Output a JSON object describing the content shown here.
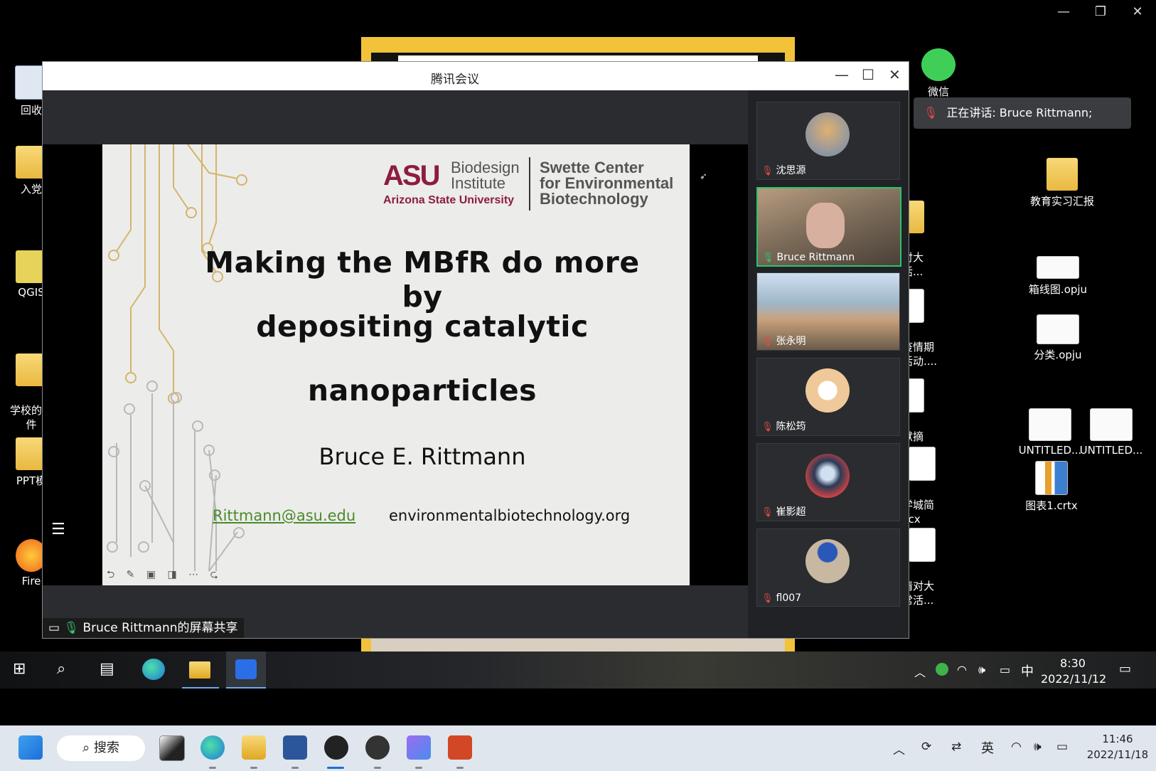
{
  "outer_window": {
    "minimize": "—",
    "restore": "❐",
    "close": "✕"
  },
  "desktop_left": [
    {
      "label": "回收",
      "kind": "recycle"
    },
    {
      "label": "入党",
      "kind": "folder"
    },
    {
      "label": "QGIS",
      "kind": "app"
    },
    {
      "label": "学校的一\n件",
      "kind": "folder"
    },
    {
      "label": "PPT模",
      "kind": "folder"
    },
    {
      "label": "Fire",
      "kind": "firefox"
    }
  ],
  "desktop_right": [
    {
      "label": "微信",
      "kind": "wechat"
    },
    {
      "label": "教育实习汇报",
      "kind": "folder"
    },
    {
      "label": "箱线图.opju",
      "kind": "chart"
    },
    {
      "label": "分类.opju",
      "kind": "chart"
    },
    {
      "label": "UNTITLED...",
      "kind": "chart"
    },
    {
      "label": "UNTITLED...",
      "kind": "chart"
    },
    {
      "label": "图表1.crtx",
      "kind": "crtx"
    }
  ],
  "desktop_mid": [
    {
      "label": "情对大\n常活..."
    },
    {
      "label": "主疫情期\n会活动...."
    },
    {
      "label": "文献摘\n.docx"
    },
    {
      "label": "大学城简\n.docx"
    },
    {
      "label": "疫情对大\n日常活..."
    }
  ],
  "meeting": {
    "title": "腾讯会议",
    "minimize": "—",
    "maximize": "☐",
    "close": "✕",
    "share_label": "Bruce Rittmann的屏幕共享",
    "slide": {
      "asu_mark": "ASU",
      "biodesign_line1": "Biodesign",
      "biodesign_line2": "Institute",
      "university": "Arizona State University",
      "swette_line1": "Swette Center",
      "swette_line2": "for Environmental",
      "swette_line3": "Biotechnology",
      "title_line1": "Making the MBfR do more by",
      "title_line2": "depositing catalytic",
      "title_line3": "nanoparticles",
      "author": "Bruce E. Rittmann",
      "email": "Rittmann@asu.edu",
      "website": "environmentalbiotechnology.org",
      "tools": "⮌ ✎ ▣ ◨ ⋯ ⮎"
    },
    "participants": [
      {
        "name": "沈思源",
        "muted": true,
        "type": "avatar",
        "color": "#c99650"
      },
      {
        "name": "Bruce Rittmann",
        "muted": false,
        "type": "video",
        "active": true
      },
      {
        "name": "张永明",
        "muted": true,
        "type": "video"
      },
      {
        "name": "陈松筠",
        "muted": true,
        "type": "avatar",
        "color": "#f0c99a"
      },
      {
        "name": "崔影超",
        "muted": true,
        "type": "avatar",
        "color": "#2a3a55"
      },
      {
        "name": "fl007",
        "muted": true,
        "type": "avatar",
        "color": "#c8b8a2"
      }
    ]
  },
  "speaking_toast": "正在讲话: Bruce Rittmann;",
  "inner_taskbar": {
    "time": "8:30",
    "date": "2022/11/12",
    "ime": "中"
  },
  "outer_taskbar": {
    "search_label": "搜索",
    "time": "11:46",
    "date": "2022/11/18",
    "ime": "英"
  }
}
